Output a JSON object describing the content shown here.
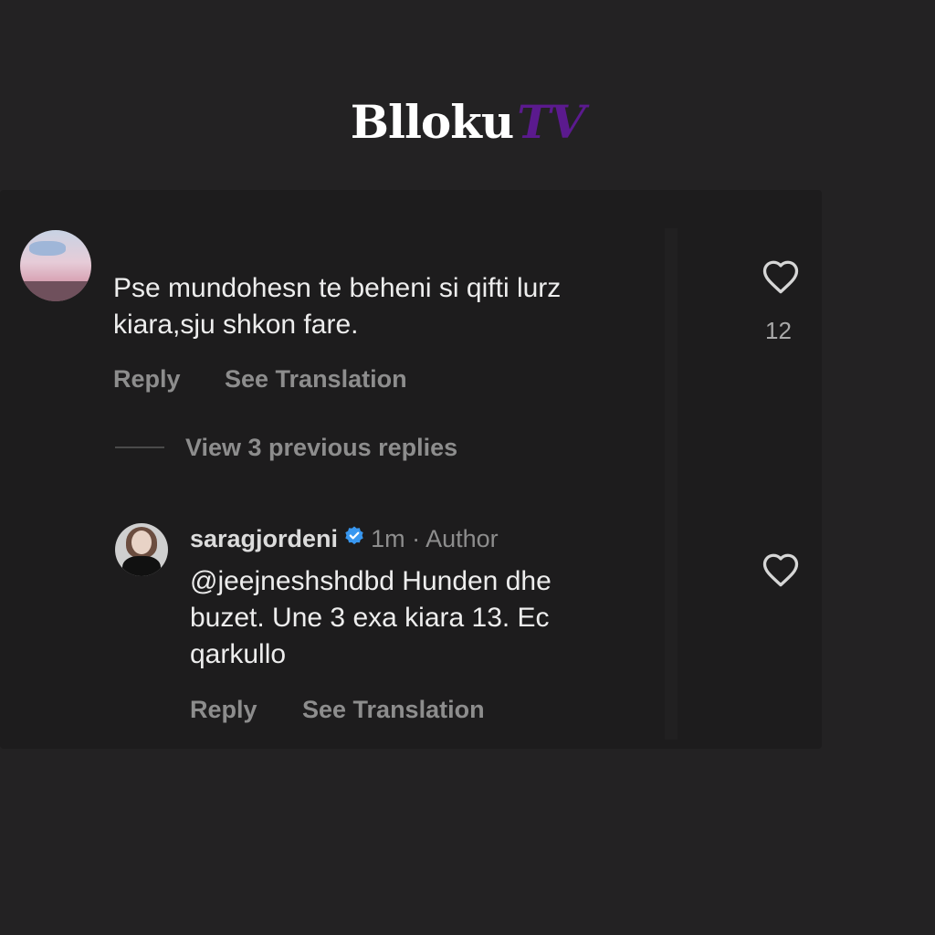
{
  "logo": {
    "main": "Blloku",
    "accent": "TV",
    "accent_color": "#5b1a8e"
  },
  "comment_1": {
    "text": "Pse mundohesn te beheni si qifti lurz\nkiara,sju shkon fare.",
    "like_count": "12",
    "reply_label": "Reply",
    "translate_label": "See Translation",
    "like_icon": "heart-outline-icon"
  },
  "view_replies": {
    "label": "View 3 previous replies"
  },
  "comment_2": {
    "username": "saragjordeni",
    "verified_icon": "verified-badge-icon",
    "time": "1m",
    "separator": "·",
    "role": "Author",
    "text": "@jeejneshshdbd Hunden dhe\nbuzet. Une 3 exa kiara 13. Ec\nqarkullo",
    "reply_label": "Reply",
    "translate_label": "See Translation",
    "like_icon": "heart-outline-icon"
  },
  "colors": {
    "background": "#232223",
    "panel": "#1d1c1d",
    "muted_text": "#8d8d8d",
    "verified_blue": "#3897f0"
  }
}
